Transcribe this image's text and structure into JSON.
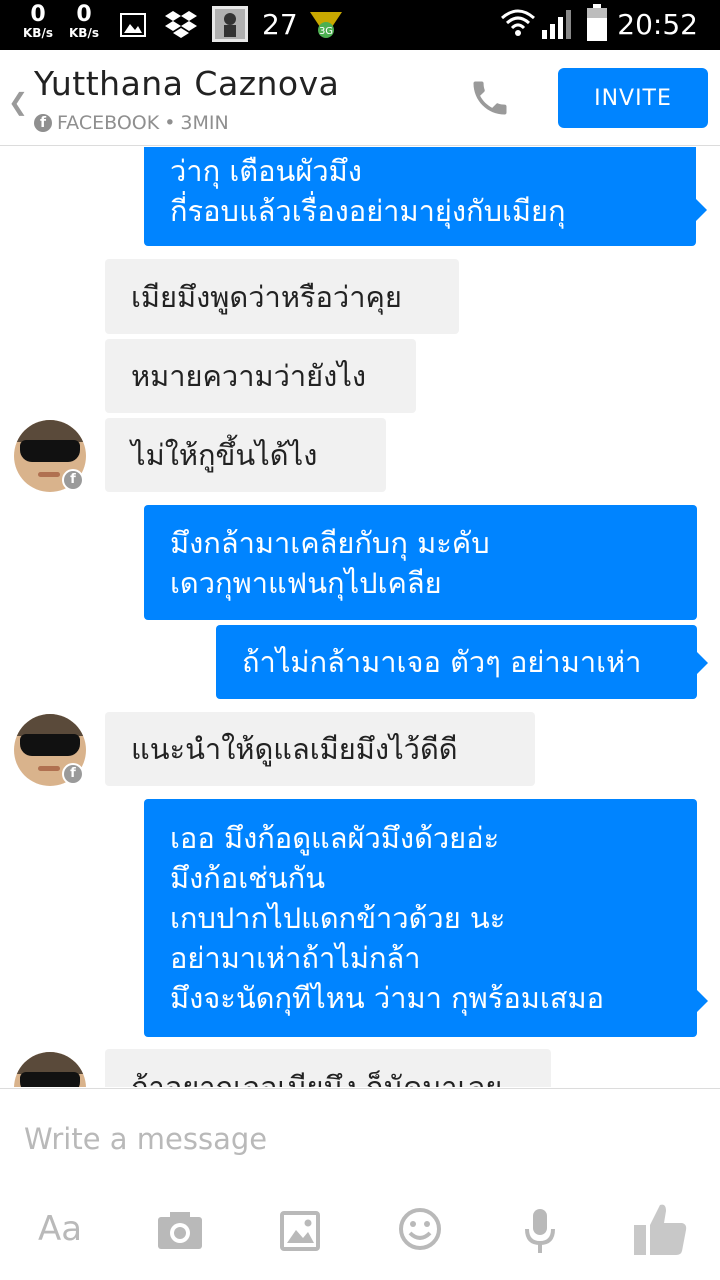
{
  "status_bar": {
    "net_down_value": "0",
    "net_down_unit": "KB/s",
    "net_up_value": "0",
    "net_up_unit": "KB/s",
    "notification_count": "27",
    "time": "20:52",
    "icons": [
      "image-icon",
      "dropbox-icon",
      "app-thumbnail-icon",
      "game-icon",
      "wifi-icon",
      "signal-icon",
      "battery-icon"
    ]
  },
  "header": {
    "back_icon": "chevron-left-icon",
    "contact_name": "Yutthana Caznova",
    "source": "FACEBOOK",
    "separator": "•",
    "time_ago": "3MIN",
    "call_icon": "phone-icon",
    "invite_label": "INVITE"
  },
  "colors": {
    "accent": "#0084ff",
    "incoming_bubble": "#f1f1f1",
    "status_bar": "#000000",
    "muted_icon": "#b9b9b9"
  },
  "messages": [
    {
      "direction": "out",
      "lines": [
        "ว่ากุ เตือนผัวมึง",
        "กี่รอบแล้วเรื่องอย่ามายุ่งกับเมียกุ"
      ]
    },
    {
      "direction": "in",
      "lines": [
        "เมียมึงพูดว่าหรือว่าคุย"
      ]
    },
    {
      "direction": "in",
      "lines": [
        "หมายความว่ายังไง"
      ]
    },
    {
      "direction": "in",
      "lines": [
        "ไม่ให้กูขึ้นได้ไง"
      ]
    },
    {
      "direction": "out",
      "lines": [
        "มึงกล้ามาเคลียกับกุ มะคับ",
        "เดวกุพาแฟนกุไปเคลีย"
      ]
    },
    {
      "direction": "out",
      "lines": [
        "ถ้าไม่กล้ามาเจอ ตัวๆ อย่ามาเห่า"
      ]
    },
    {
      "direction": "in",
      "lines": [
        "แนะนำให้ดูแลเมียมึงไว้ดีดี"
      ]
    },
    {
      "direction": "out",
      "lines": [
        "เออ มึงก้อดูแลผัวมึงด้วยอ่ะ",
        "มึงก้อเช่นกัน",
        "เกบปากไปแดกข้าวด้วย นะ",
        "อย่ามาเห่าถ้าไม่กล้า",
        "มึงจะนัดกุทีไหน ว่ามา กุพร้อมเสมอ"
      ]
    },
    {
      "direction": "in",
      "lines": [
        "ถ้าอยากเจอเมียมึง ก็นัดมาเลย"
      ]
    }
  ],
  "composer": {
    "placeholder": "Write a message",
    "text_format_label": "Aa",
    "icons": [
      "camera-icon",
      "gallery-icon",
      "emoji-icon",
      "microphone-icon",
      "like-icon"
    ]
  }
}
